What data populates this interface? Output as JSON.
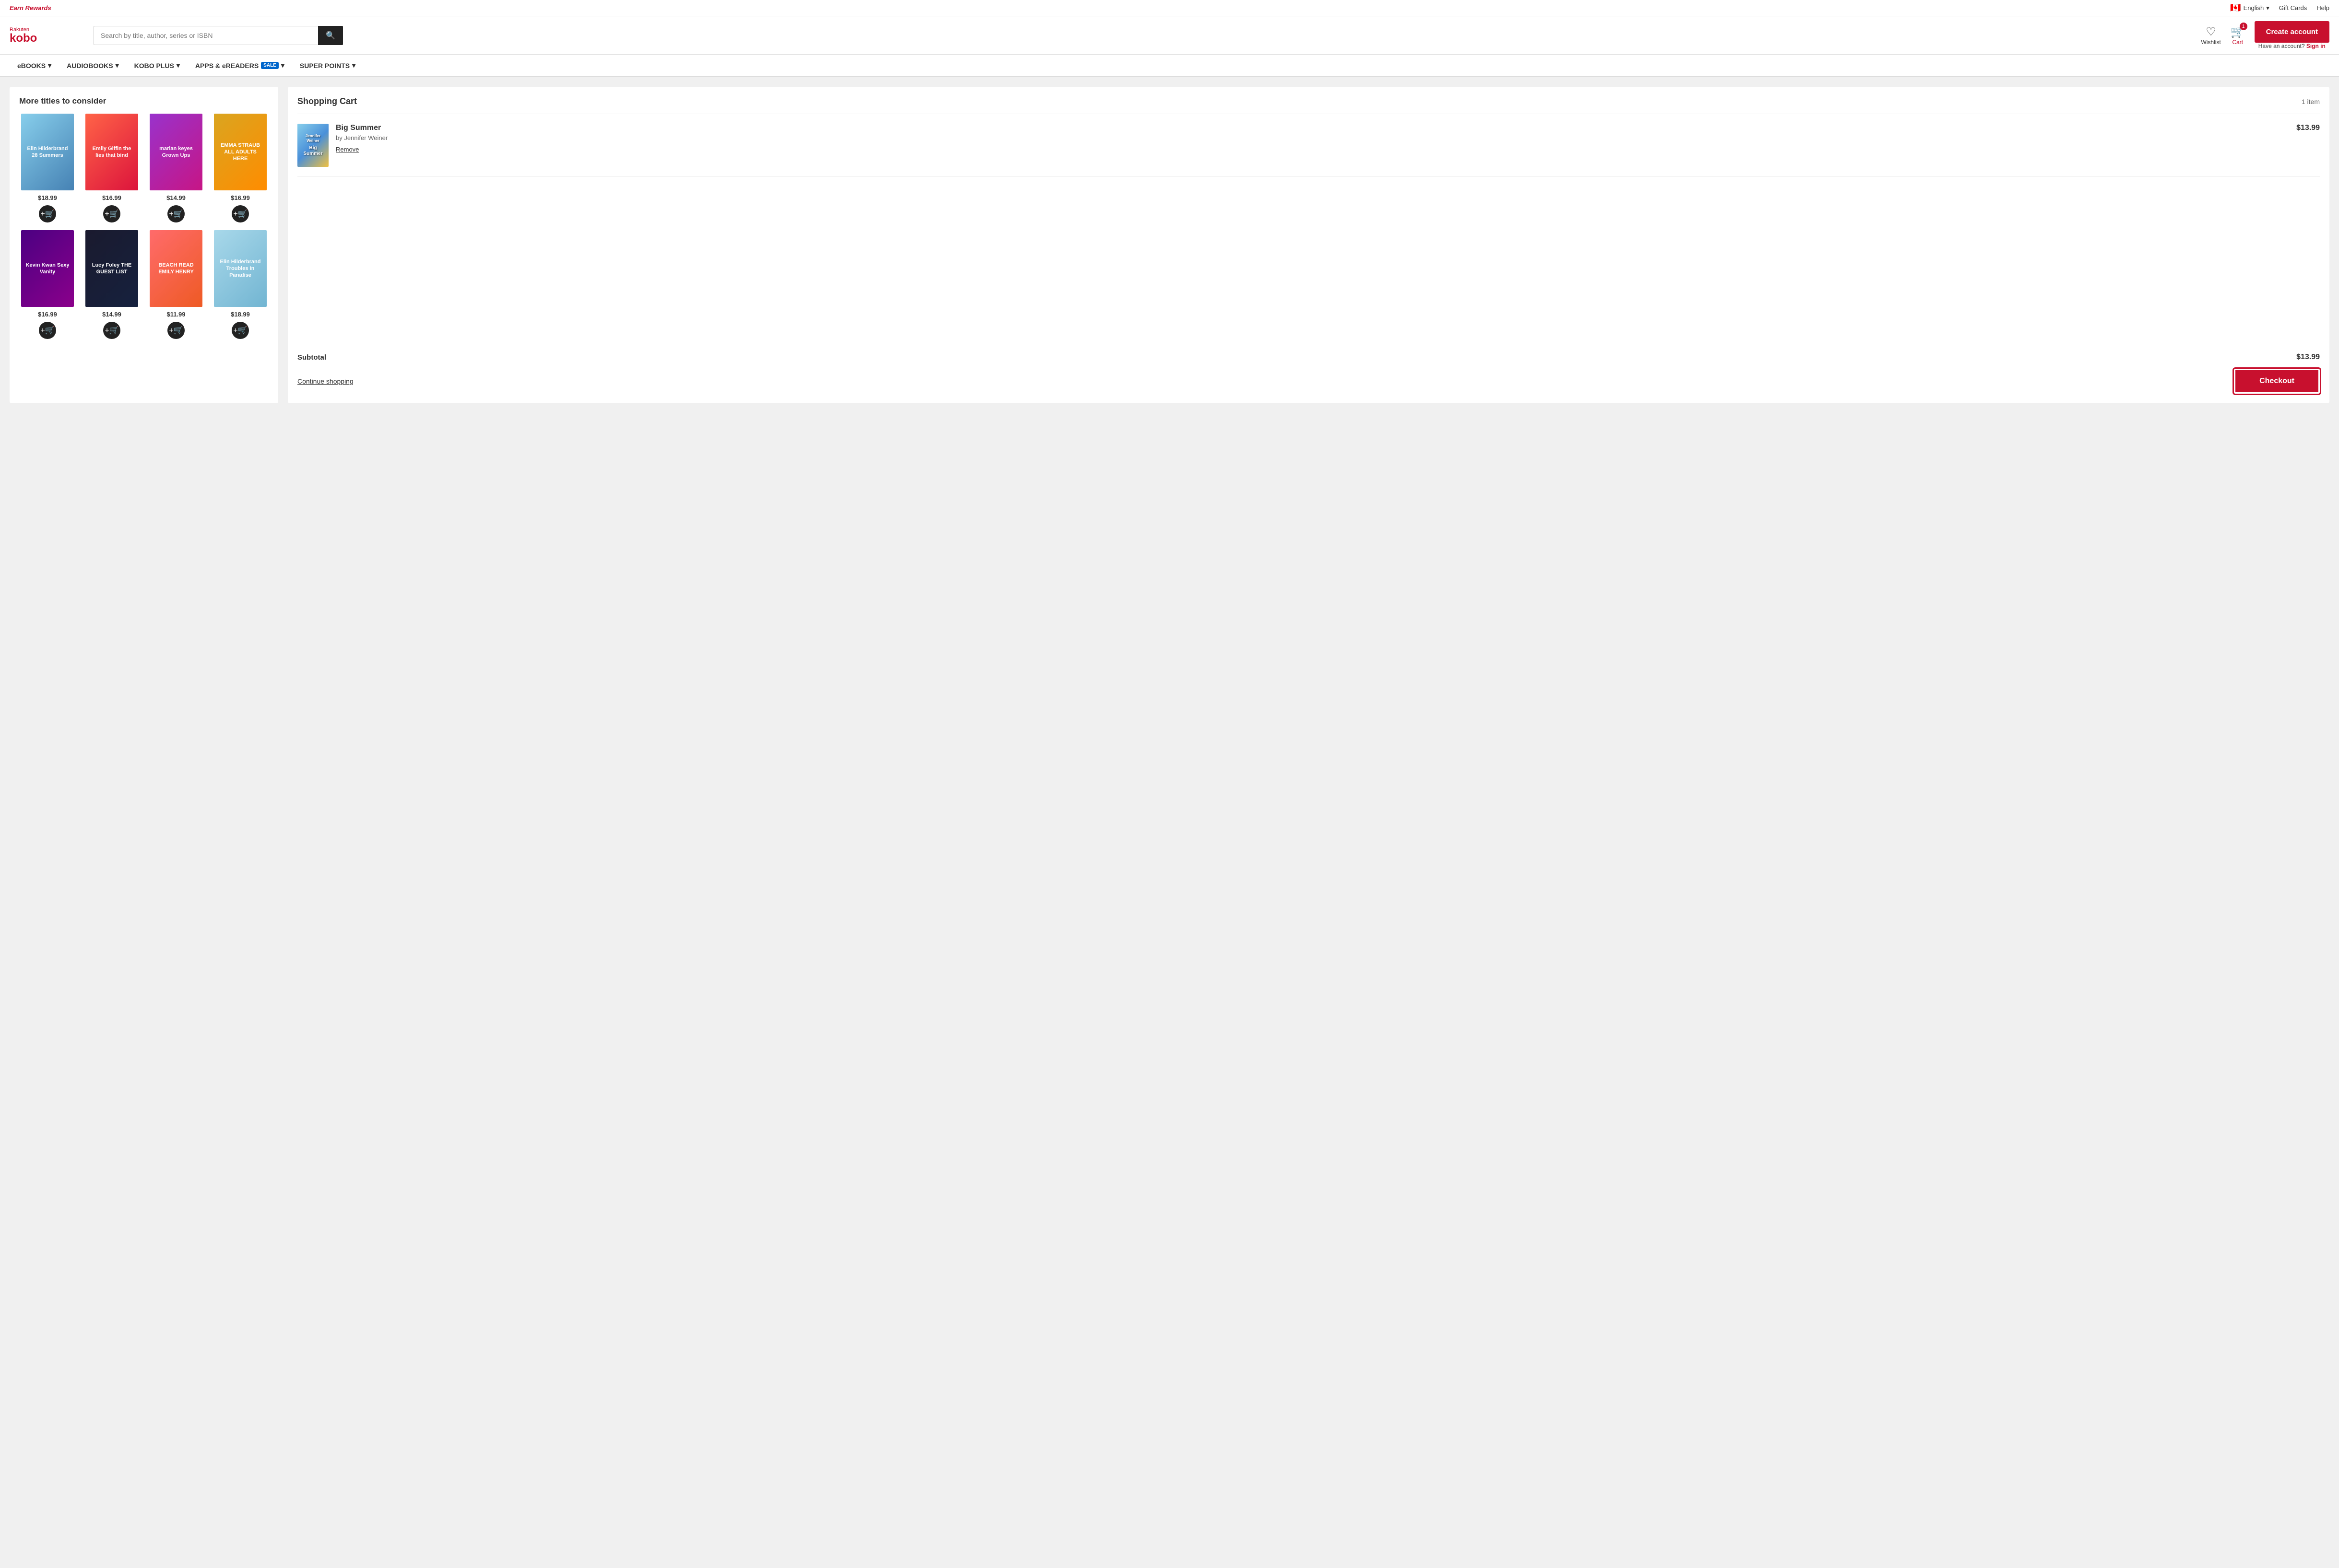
{
  "promo": {
    "earn_rewards": "Earn Rewards",
    "language": "English",
    "gift_cards": "Gift Cards",
    "help": "Help"
  },
  "header": {
    "logo_brand": "Rakuten kobo",
    "search_placeholder": "Search by title, author, series or ISBN",
    "wishlist_label": "Wishlist",
    "cart_label": "Cart",
    "cart_count": "1",
    "create_account": "Create account",
    "signin_prompt": "Have an account?",
    "signin_link": "Sign in"
  },
  "nav": {
    "items": [
      {
        "label": "eBOOKS",
        "has_dropdown": true
      },
      {
        "label": "AUDIOBOOKS",
        "has_dropdown": true
      },
      {
        "label": "KOBO PLUS",
        "has_dropdown": true
      },
      {
        "label": "APPS & eREADERS",
        "has_dropdown": true,
        "has_sale": true
      },
      {
        "label": "SUPER POINTS",
        "has_dropdown": true
      }
    ],
    "sale_badge": "SALE"
  },
  "titles_section": {
    "heading": "More titles to consider",
    "books": [
      {
        "title": "Elin Hilderbrand 28 Summers",
        "price": "$18.99",
        "cover_class": "cover-1"
      },
      {
        "title": "Emily Giffin the lies that bind",
        "price": "$16.99",
        "cover_class": "cover-2"
      },
      {
        "title": "marian keyes Grown Ups",
        "price": "$14.99",
        "cover_class": "cover-3"
      },
      {
        "title": "EMMA STRAUB ALL ADULTS HERE",
        "price": "$16.99",
        "cover_class": "cover-4"
      },
      {
        "title": "Kevin Kwan Sexy Vanity",
        "price": "$16.99",
        "cover_class": "cover-5"
      },
      {
        "title": "Lucy Foley THE GUEST LIST",
        "price": "$14.99",
        "cover_class": "cover-6"
      },
      {
        "title": "BEACH READ EMILY HENRY",
        "price": "$11.99",
        "cover_class": "cover-7"
      },
      {
        "title": "Elin Hilderbrand Troubles in Paradise",
        "price": "$18.99",
        "cover_class": "cover-8"
      }
    ]
  },
  "cart": {
    "title": "Shopping Cart",
    "item_count": "1 item",
    "items": [
      {
        "title": "Big Summer",
        "author": "by Jennifer Weiner",
        "price": "$13.99",
        "remove_label": "Remove"
      }
    ],
    "subtotal_label": "Subtotal",
    "subtotal_amount": "$13.99",
    "continue_shopping": "Continue shopping",
    "checkout_label": "Checkout"
  }
}
